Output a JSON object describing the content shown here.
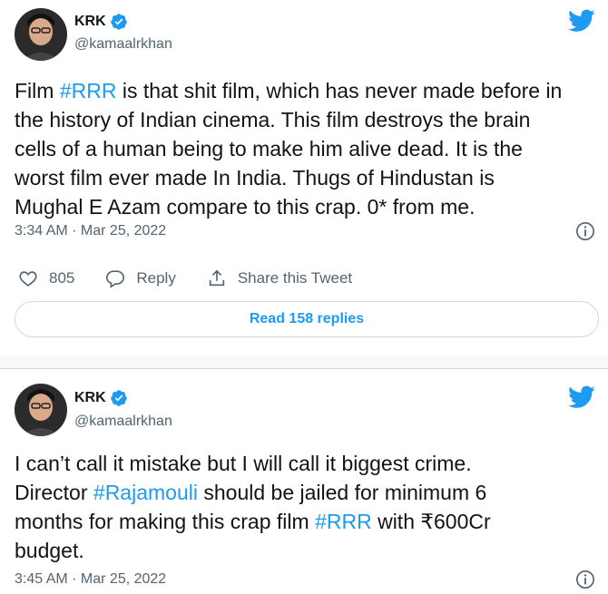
{
  "tweets": [
    {
      "author_name": "KRK",
      "handle": "@kamaalrkhan",
      "text_parts": [
        {
          "t": "Film ",
          "tag": false
        },
        {
          "t": "#RRR",
          "tag": true
        },
        {
          "t": " is that shit film, which has never made before in\nthe history of Indian cinema. This film destroys the brain\ncells of a human being to make him alive dead. It is the\nworst film ever made In India. Thugs of Hindustan is\nMughal E Azam compare to this crap. 0* from me.",
          "tag": false
        }
      ],
      "timestamp": "3:34 AM · Mar 25, 2022",
      "likes": "805",
      "reply_label": "Reply",
      "share_label": "Share this Tweet",
      "read_replies_label": "Read 158 replies"
    },
    {
      "author_name": "KRK",
      "handle": "@kamaalrkhan",
      "text_parts": [
        {
          "t": "I can’t call it mistake but I will call it biggest crime.\nDirector ",
          "tag": false
        },
        {
          "t": "#Rajamouli",
          "tag": true
        },
        {
          "t": " should be jailed for minimum 6\nmonths for making this crap film ",
          "tag": false
        },
        {
          "t": "#RRR",
          "tag": true
        },
        {
          "t": " with ₹600Cr\nbudget.",
          "tag": false
        }
      ],
      "timestamp": "3:45 AM · Mar 25, 2022"
    }
  ],
  "colors": {
    "accent": "#1d9bf0",
    "text": "#0f1419",
    "muted": "#536471",
    "border": "#cfd9de"
  },
  "icons": [
    "avatar",
    "verified-badge-icon",
    "twitter-bird-icon",
    "info-icon",
    "heart-icon",
    "reply-bubble-icon",
    "share-icon"
  ]
}
